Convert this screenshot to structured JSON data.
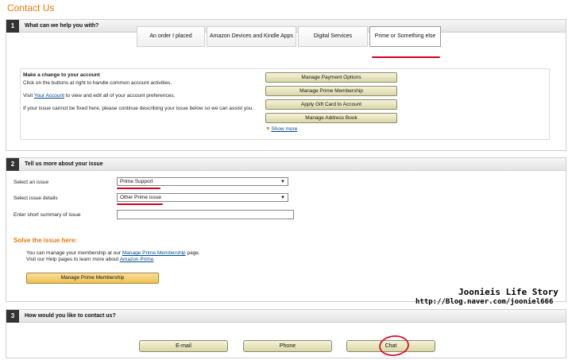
{
  "page": {
    "title": "Contact Us"
  },
  "section1": {
    "num": "1",
    "title": "What can we help you with?",
    "tabs": [
      {
        "label": "An order I placed"
      },
      {
        "label": "Amazon Devices and Kindle Apps"
      },
      {
        "label": "Digital Services"
      },
      {
        "label": "Prime or Something else"
      }
    ],
    "account": {
      "heading": "Make a change to your account",
      "line1": "Click on the buttons at right to handle common account activities.",
      "line2_pre": "Visit ",
      "line2_link": "Your Account",
      "line2_post": " to view and edit all of your account preferences.",
      "line3": "If your issue cannot be fixed here, please continue describing your issue below so we can assist you."
    },
    "buttons": [
      {
        "label": "Manage Payment Options"
      },
      {
        "label": "Manage Prime Membership"
      },
      {
        "label": "Apply Gift Card to Account"
      },
      {
        "label": "Manage Address Book"
      }
    ],
    "show_more": "Show more"
  },
  "section2": {
    "num": "2",
    "title": "Tell us more about your issue",
    "issue_label": "Select an issue",
    "issue_value": "Prime Support",
    "details_label": "Select issue details",
    "details_value": "Other Prime issue",
    "summary_label": "Enter short summary of issue",
    "solve_title": "Solve the issue here:",
    "solve_line1_pre": "You can manage your membership at our ",
    "solve_line1_link": "Manage Prime Membership",
    "solve_line1_post": " page.",
    "solve_line2_pre": "Visit our Help pages to learn more about ",
    "solve_line2_link": "Amazon Prime",
    "solve_line2_post": ".",
    "prime_button": "Manage Prime Membership"
  },
  "section3": {
    "num": "3",
    "title": "How would you like to contact us?",
    "buttons": [
      {
        "label": "E-mail"
      },
      {
        "label": "Phone"
      },
      {
        "label": "Chat"
      }
    ]
  },
  "watermark": {
    "line1": "Joonieis Life Story",
    "line2": "http://Blog.naver.com/jooniel666"
  },
  "colors": {
    "accent": "#e47911",
    "link": "#004b91",
    "annotation": "#d6001c"
  }
}
